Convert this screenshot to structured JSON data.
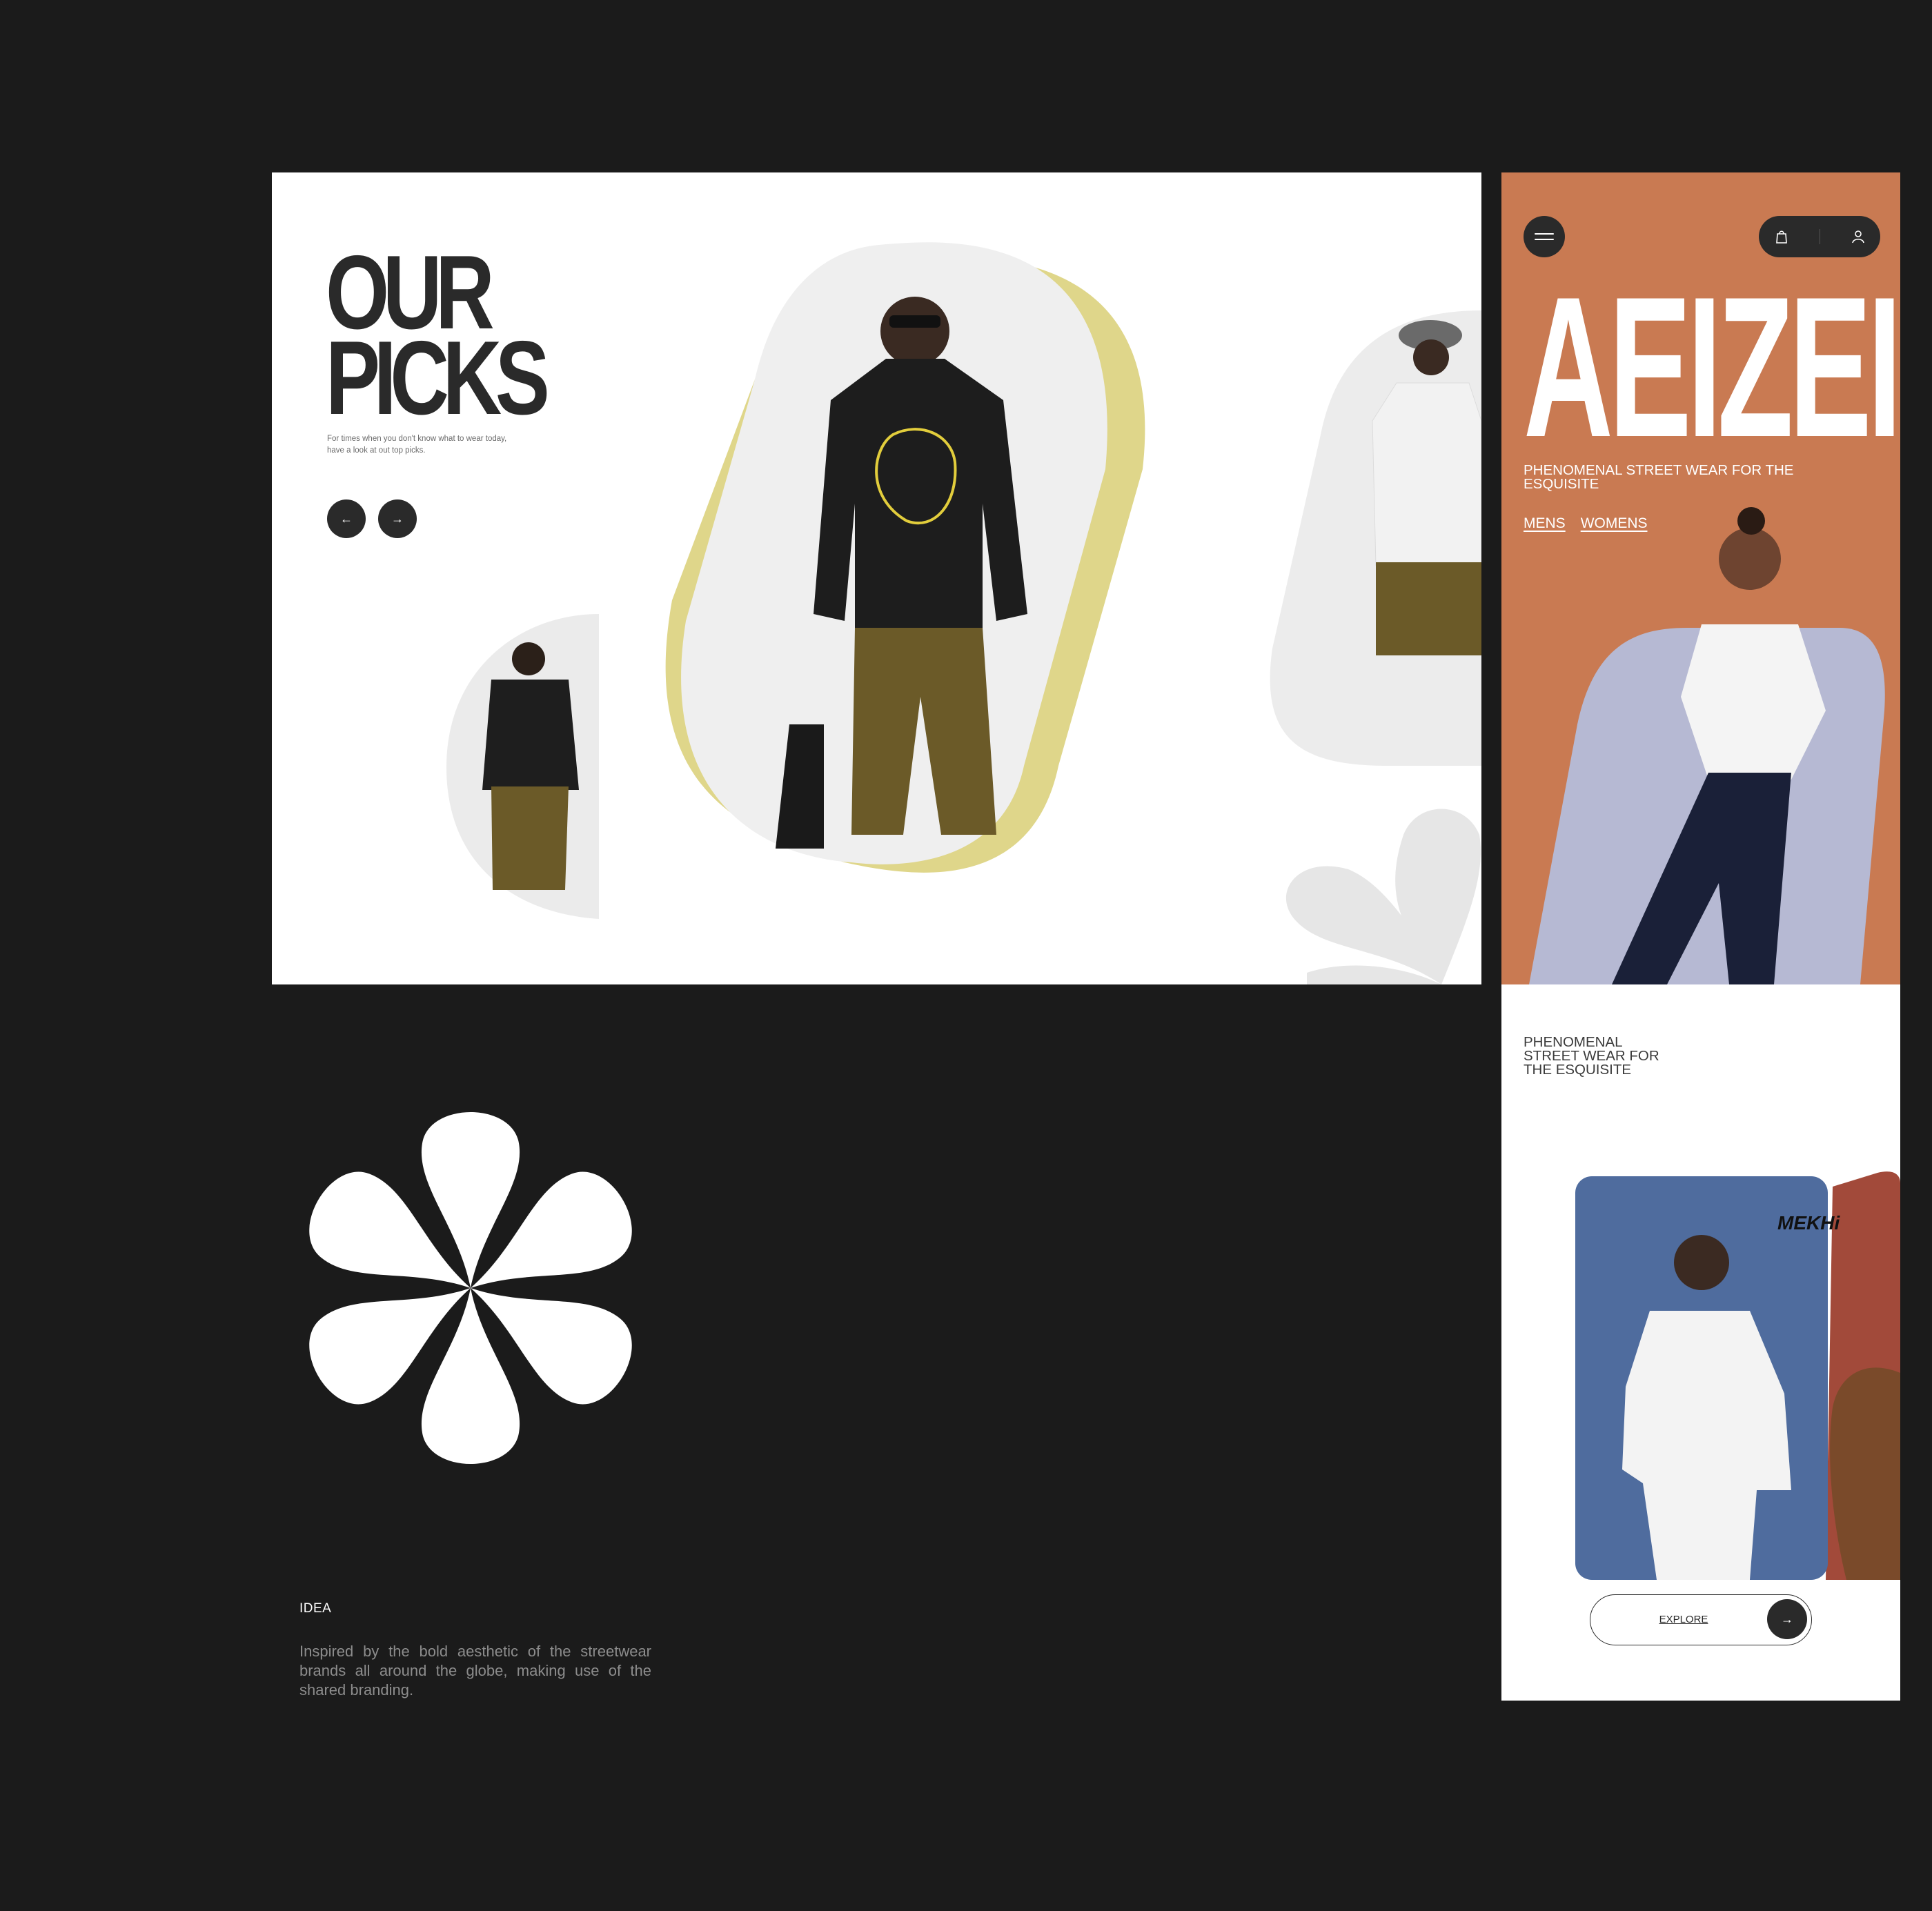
{
  "picks": {
    "title": "OUR\nPICKS",
    "subtitle": "For times when you don't know what to wear today, have a look at out top picks.",
    "prev_icon": "arrow-left-icon",
    "next_icon": "arrow-right-icon"
  },
  "mobile": {
    "menu_icon": "hamburger-icon",
    "bag_icon": "shopping-bag-icon",
    "user_icon": "user-icon",
    "brand": "AEIZEI",
    "tagline": "PHENOMENAL STREET WEAR FOR THE ESQUISITE",
    "links": [
      "MENS",
      "WOMENS"
    ],
    "section_tagline": "PHENOMENAL STREET WEAR FOR THE ESQUISITE",
    "card_signature": "MEKHi",
    "explore_label": "EXPLORE",
    "explore_icon": "arrow-right-icon"
  },
  "idea": {
    "label": "IDEA",
    "body": "Inspired by the bold aesthetic of the streetwear brands all around the globe, making use of the shared branding."
  },
  "colors": {
    "background": "#1b1b1b",
    "hero_orange": "#c97a52",
    "accent_yellow": "#dfd68a",
    "lavender": "#b6b9d3",
    "card_blue": "#4f6c9e",
    "dark": "#2a2a2a"
  }
}
